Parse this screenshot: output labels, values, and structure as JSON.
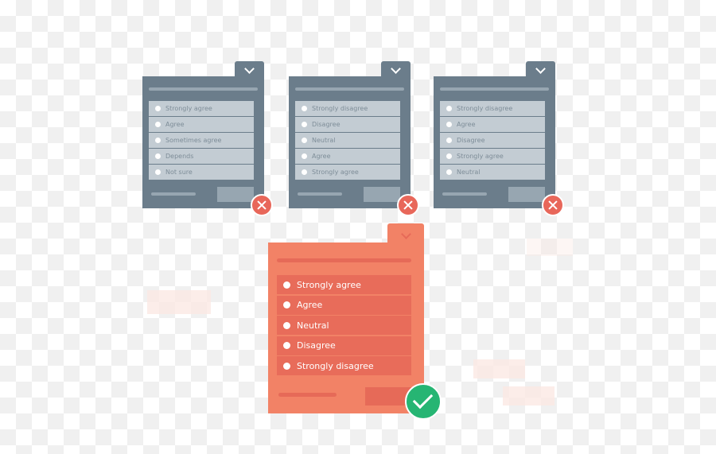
{
  "cards": [
    {
      "status": "incorrect",
      "options": [
        "Strongly agree",
        "Agree",
        "Sometimes agree",
        "Depends",
        "Not sure"
      ]
    },
    {
      "status": "incorrect",
      "options": [
        "Strongly disagree",
        "Disagree",
        "Neutral",
        "Agree",
        "Strongly agree"
      ]
    },
    {
      "status": "incorrect",
      "options": [
        "Strongly disagree",
        "Agree",
        "Disagree",
        "Strongly agree",
        "Neutral"
      ]
    }
  ],
  "correct_card": {
    "status": "correct",
    "options": [
      "Strongly agree",
      "Agree",
      "Neutral",
      "Disagree",
      "Strongly disagree"
    ]
  },
  "colors": {
    "gray_card": "#6b7d8b",
    "orange_card": "#f28266",
    "error": "#e8675a",
    "success": "#26b573"
  }
}
